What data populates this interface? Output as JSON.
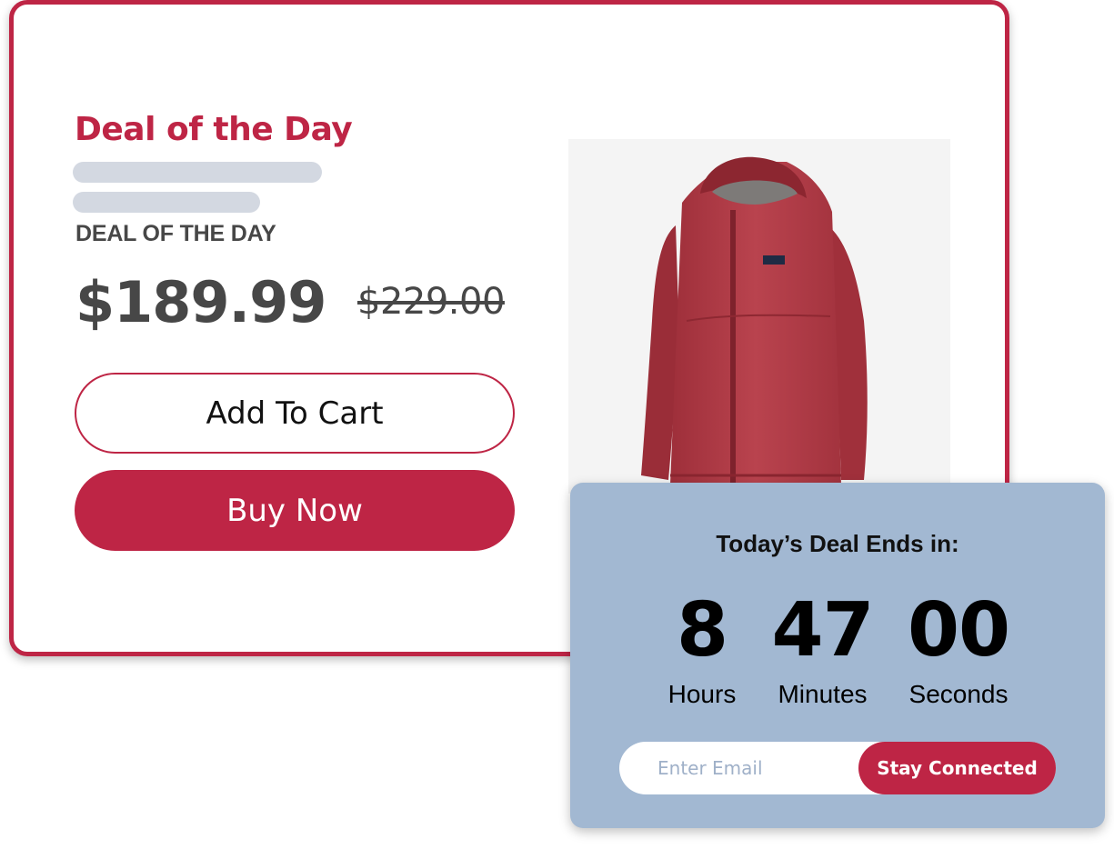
{
  "deal": {
    "title": "Deal of the Day",
    "eyebrow": "DEAL OF THE DAY",
    "price": "$189.99",
    "original_price": "$229.00",
    "add_to_cart_label": "Add To Cart",
    "buy_now_label": "Buy Now"
  },
  "product": {
    "image_icon": "jacket-image",
    "color": "#b43a45"
  },
  "timer": {
    "title": "Today’s Deal Ends in:",
    "hours": "8",
    "hours_label": "Hours",
    "minutes": "47",
    "minutes_label": "Minutes",
    "seconds": "00",
    "seconds_label": "Seconds"
  },
  "subscribe": {
    "email_placeholder": "Enter Email",
    "email_value": "",
    "button_label": "Stay Connected"
  },
  "colors": {
    "brand": "#be2545",
    "timer_bg": "#a2b8d2",
    "text_dark": "#474747",
    "skeleton": "#d3d8e1"
  }
}
